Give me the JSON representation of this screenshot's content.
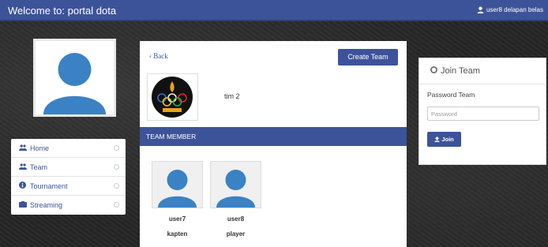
{
  "topbar": {
    "brand": "Welcome to: portal dota",
    "user_label": "user8 delapan belas",
    "user_icon": "user-icon"
  },
  "sidebar": {
    "items": [
      {
        "label": "Home",
        "icon": "users-icon"
      },
      {
        "label": "Team",
        "icon": "users-icon"
      },
      {
        "label": "Tournament",
        "icon": "info-icon"
      },
      {
        "label": "Streaming",
        "icon": "video-icon"
      }
    ]
  },
  "team": {
    "back_label": "‹ Back",
    "create_label": "Create Team",
    "name": "tim 2",
    "member_header": "TEAM MEMBER",
    "members": [
      {
        "name": "user7",
        "role": "kapten"
      },
      {
        "name": "user8",
        "role": "player"
      }
    ]
  },
  "join": {
    "title": "Join Team",
    "password_label": "Password Team",
    "password_placeholder": "Password",
    "button_label": "Join"
  },
  "colors": {
    "primary": "#3d5399",
    "avatar_blue": "#3a82c4"
  }
}
